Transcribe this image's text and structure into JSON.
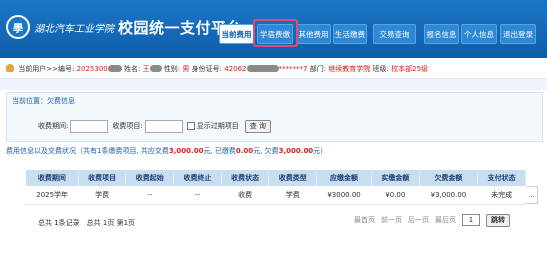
{
  "header": {
    "emblem_glyph": "學",
    "school_name": "湖北汽车工业学院",
    "platform_title": "校园统一支付平台",
    "nav": [
      {
        "label": "当前费用",
        "active": true
      },
      {
        "label": "学宿费缴",
        "active": false
      },
      {
        "label": "其他费用",
        "active": false
      },
      {
        "label": "生活缴费",
        "active": false
      },
      {
        "label": "交易查询",
        "active": false
      },
      {
        "label": "报名信息",
        "active": false
      },
      {
        "label": "个人信息",
        "active": false
      },
      {
        "label": "退出登录",
        "active": false
      }
    ],
    "highlight_color": "#e54a6a",
    "brand_color": "#1a76c8"
  },
  "userbar": {
    "prefix": "当前用户>>编号:",
    "id_value": "2025300",
    "name_label": "姓名:",
    "name_value": "王",
    "gender_label": "性别:",
    "gender_value": "男",
    "idcard_label": "身份证号:",
    "idcard_prefix": "42062",
    "idcard_suffix": "*******7",
    "dept_label": "部门:",
    "dept_value": "继续教育学院",
    "class_label": "班级:",
    "class_value": "校本部25级"
  },
  "breadcrumb": "当前位置：欠费信息",
  "search": {
    "period_label": "收费期间:",
    "item_label": "收费项目:",
    "show_expired_label": "显示过期项目",
    "query_button": "查 询"
  },
  "summary": {
    "prefix": "费用信息以及交费状况",
    "text1": "（共有1条缴费项目, 共应交费",
    "due": "3,000.00",
    "text2": "元, 已缴费",
    "paid": "0.00",
    "text3": "元, 欠费",
    "owed": "3,000.00",
    "text4": "元）"
  },
  "table": {
    "columns": [
      "收费期间",
      "收费项目",
      "收费起始",
      "收费终止",
      "收费状态",
      "收费类型",
      "应缴金额",
      "实缴金额",
      "欠费金额",
      "支付状态"
    ],
    "rows": [
      [
        "2025学年",
        "学费",
        "--",
        "--",
        "收费",
        "学费",
        "¥3000.00",
        "¥0.00",
        "¥3,000.00",
        "未完成"
      ]
    ],
    "stub": "..."
  },
  "pager": {
    "summary": "总共 1条记录　总共 1页 第1页",
    "first": "最首页",
    "prev": "前一页",
    "next": "后一页",
    "last": "最后页",
    "page_value": "1",
    "goto": "跳转"
  }
}
